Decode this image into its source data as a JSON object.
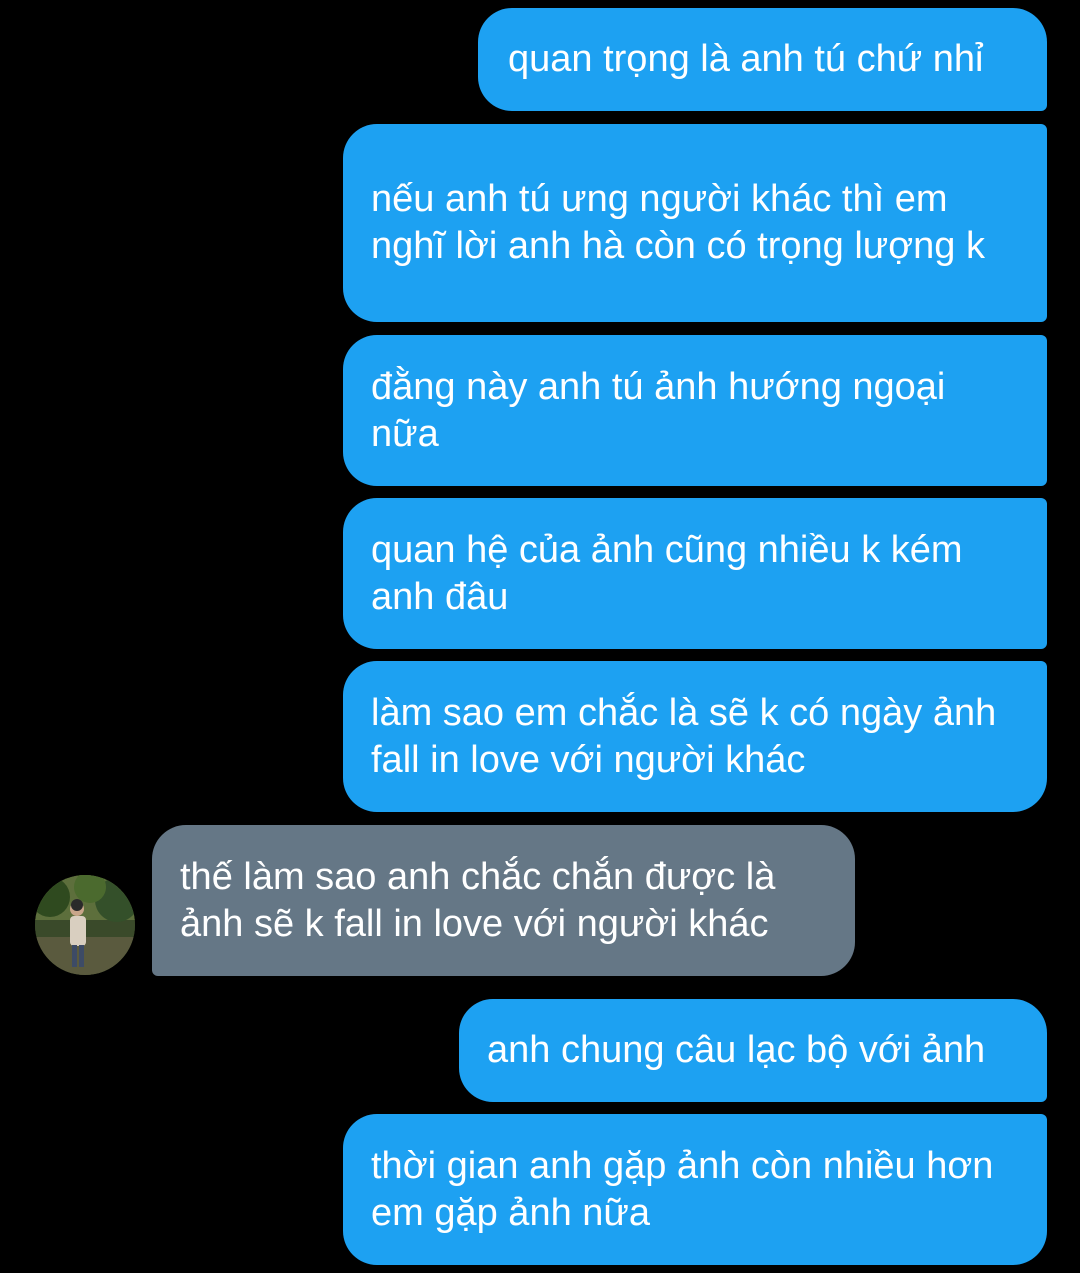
{
  "colors": {
    "background": "#000000",
    "outgoing_bubble": "#1da1f2",
    "incoming_bubble": "#657786",
    "text": "#ffffff"
  },
  "messages": [
    {
      "direction": "outgoing",
      "text": "quan trọng là anh tú chứ nhỉ"
    },
    {
      "direction": "outgoing",
      "text": "nếu anh tú ưng người khác thì em nghĩ lời anh hà còn có trọng lượng k"
    },
    {
      "direction": "outgoing",
      "text": "đằng này anh tú ảnh hướng ngoại nữa"
    },
    {
      "direction": "outgoing",
      "text": "quan hệ của ảnh cũng nhiều k kém anh đâu"
    },
    {
      "direction": "outgoing",
      "text": "làm sao em chắc là sẽ k có ngày ảnh fall in love với người khác"
    },
    {
      "direction": "incoming",
      "text": "thế làm sao anh chắc chắn được là ảnh sẽ k fall in love với người khác",
      "avatar": "user-avatar-photo"
    },
    {
      "direction": "outgoing",
      "text": "anh chung câu lạc bộ với ảnh"
    },
    {
      "direction": "outgoing",
      "text": "thời gian anh gặp ảnh còn nhiều hơn em gặp ảnh nữa"
    }
  ]
}
